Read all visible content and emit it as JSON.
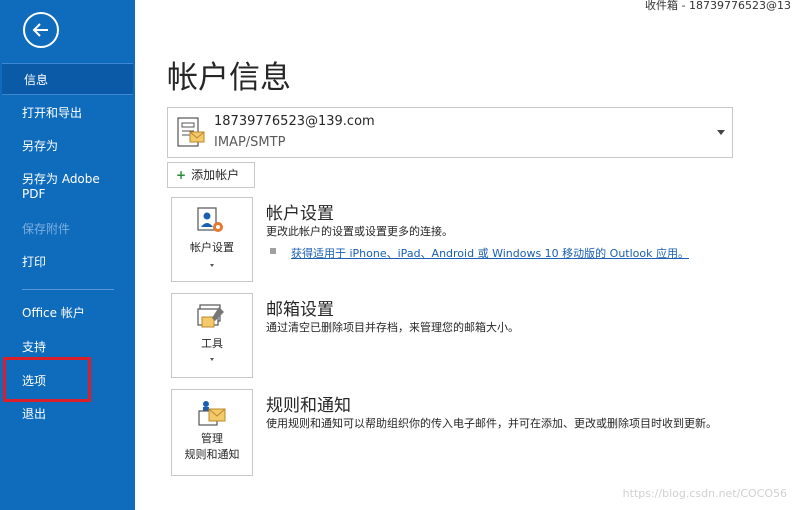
{
  "window": {
    "title": "收件箱 - 18739776523@13"
  },
  "sidebar": {
    "items": [
      {
        "label": "信息"
      },
      {
        "label": "打开和导出"
      },
      {
        "label": "另存为"
      },
      {
        "label": "另存为 Adobe",
        "label2": "PDF"
      },
      {
        "label": "保存附件"
      },
      {
        "label": "打印"
      },
      {
        "label": "Office 帐户"
      },
      {
        "label": "支持"
      },
      {
        "label": "选项"
      },
      {
        "label": "退出"
      }
    ]
  },
  "main": {
    "title": "帐户信息",
    "account": {
      "email": "18739776523@139.com",
      "type": "IMAP/SMTP"
    },
    "add_account_label": "添加帐户",
    "sections": [
      {
        "tile_label": "帐户设置",
        "title": "帐户设置",
        "desc": "更改此帐户的设置或设置更多的连接。",
        "link": "获得适用于 iPhone、iPad、Android 或 Windows 10 移动版的 Outlook 应用。"
      },
      {
        "tile_label": "工具",
        "title": "邮箱设置",
        "desc": "通过清空已删除项目并存档，来管理您的邮箱大小。"
      },
      {
        "tile_label": "管理",
        "tile_label2": "规则和通知",
        "title": "规则和通知",
        "desc": "使用规则和通知可以帮助组织你的传入电子邮件，并可在添加、更改或删除项目时收到更新。"
      }
    ]
  },
  "watermark": "https://blog.csdn.net/COCO56",
  "colors": {
    "sidebar": "#0f6cbd",
    "highlight": "#d9202a",
    "link": "#1a5fb4"
  }
}
